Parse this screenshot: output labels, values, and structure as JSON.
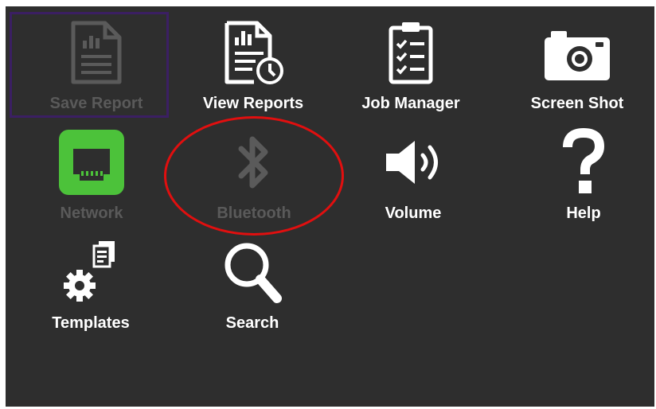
{
  "menu": {
    "items": [
      {
        "id": "save-report",
        "label": "Save Report",
        "icon": "report-document-icon",
        "enabled": false,
        "focused": true
      },
      {
        "id": "view-reports",
        "label": "View Reports",
        "icon": "report-history-icon",
        "enabled": true
      },
      {
        "id": "job-manager",
        "label": "Job Manager",
        "icon": "clipboard-checklist-icon",
        "enabled": true
      },
      {
        "id": "screen-shot",
        "label": "Screen Shot",
        "icon": "camera-icon",
        "enabled": true
      },
      {
        "id": "network",
        "label": "Network",
        "icon": "ethernet-port-icon",
        "enabled": false
      },
      {
        "id": "bluetooth",
        "label": "Bluetooth",
        "icon": "bluetooth-icon",
        "enabled": false
      },
      {
        "id": "volume",
        "label": "Volume",
        "icon": "speaker-icon",
        "enabled": true
      },
      {
        "id": "help",
        "label": "Help",
        "icon": "question-mark-icon",
        "enabled": true
      },
      {
        "id": "templates",
        "label": "Templates",
        "icon": "gear-document-icon",
        "enabled": true
      },
      {
        "id": "search",
        "label": "Search",
        "icon": "magnifier-icon",
        "enabled": true
      }
    ]
  },
  "colors": {
    "background": "#2e2e2e",
    "icon_enabled": "#ffffff",
    "icon_disabled": "#5a5a5a",
    "network_accent": "#4cc23a",
    "focus_frame": "#3b1f63",
    "highlight_circle": "#e10f0f"
  }
}
